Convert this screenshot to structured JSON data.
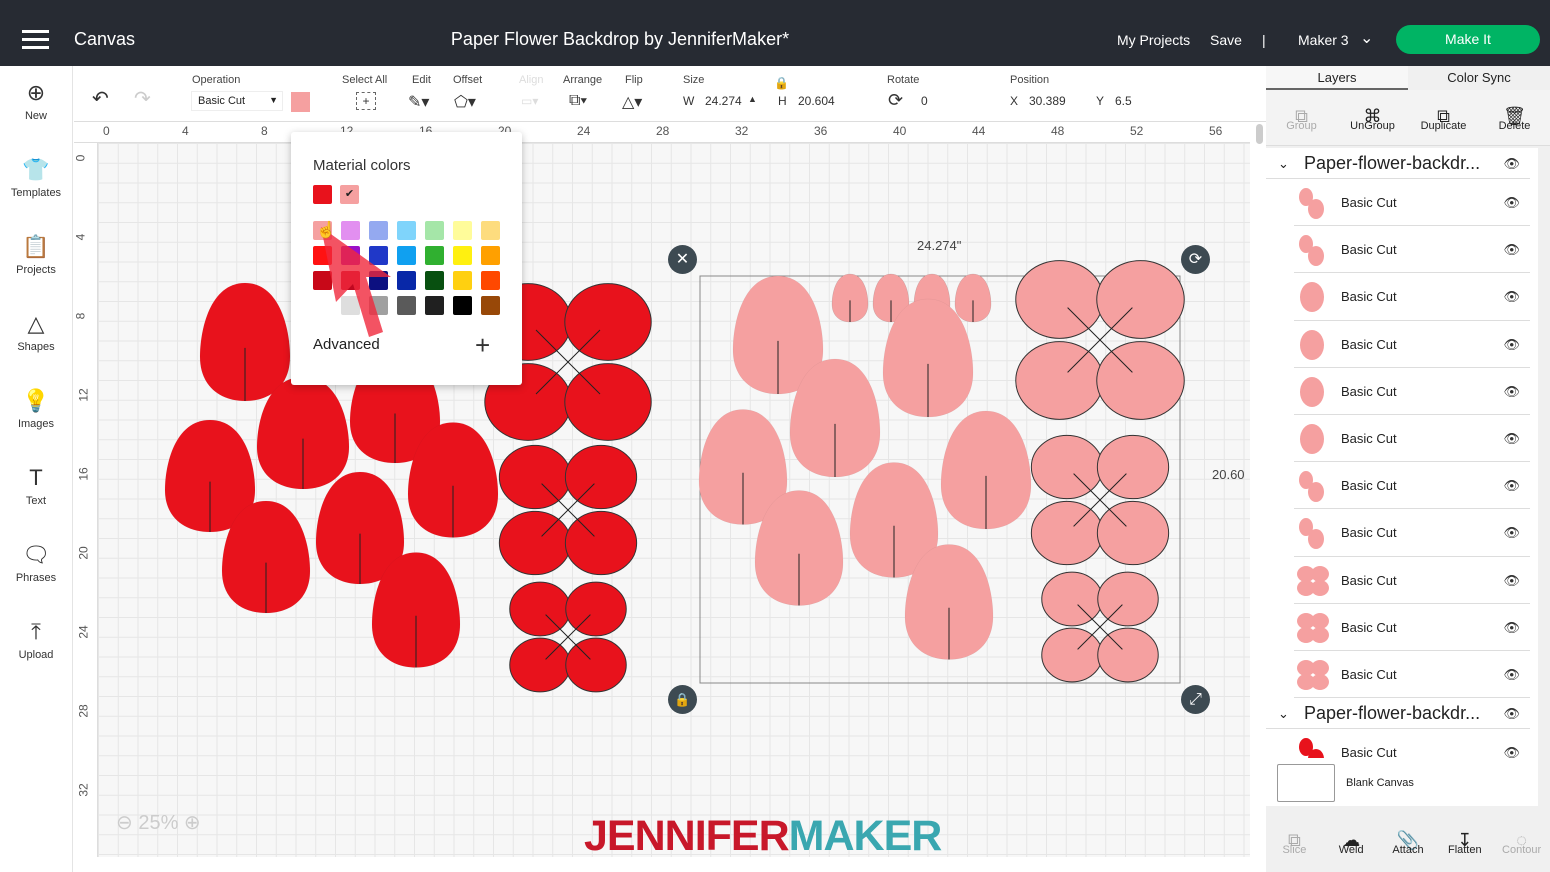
{
  "topbar": {
    "app": "Canvas",
    "title": "Paper Flower Backdrop by JenniferMaker*",
    "my_projects": "My Projects",
    "save": "Save",
    "separator": "|",
    "machine": "Maker 3",
    "make_it": "Make It",
    "accent": "#00b464"
  },
  "sidebar": [
    {
      "label": "New",
      "icon": "plus-circle-icon"
    },
    {
      "label": "Templates",
      "icon": "shirt-icon"
    },
    {
      "label": "Projects",
      "icon": "clipboard-icon"
    },
    {
      "label": "Shapes",
      "icon": "shapes-icon"
    },
    {
      "label": "Images",
      "icon": "bulb-icon"
    },
    {
      "label": "Text",
      "icon": "text-icon"
    },
    {
      "label": "Phrases",
      "icon": "speech-icon"
    },
    {
      "label": "Upload",
      "icon": "upload-icon"
    }
  ],
  "toolbar": {
    "operation_label": "Operation",
    "operation_value": "Basic Cut",
    "operation_color": "#f5a0a0",
    "select_all": "Select All",
    "edit": "Edit",
    "offset": "Offset",
    "align": "Align",
    "arrange": "Arrange",
    "flip": "Flip",
    "size": "Size",
    "w_label": "W",
    "w": "24.274",
    "h_label": "H",
    "h": "20.604",
    "rotate": "Rotate",
    "rotate_value": "0",
    "position": "Position",
    "x_label": "X",
    "x": "30.389",
    "y_label": "Y",
    "y": "6.5"
  },
  "ruler": {
    "top": [
      "0",
      "4",
      "8",
      "12",
      "16",
      "20",
      "24",
      "28",
      "32",
      "36",
      "40",
      "44",
      "48",
      "52",
      "56"
    ],
    "left": [
      "0",
      "4",
      "8",
      "12",
      "16",
      "20",
      "24",
      "28",
      "32"
    ]
  },
  "color_popup": {
    "title": "Material colors",
    "current": [
      "#e8121c",
      "#f5a0a0"
    ],
    "grid": [
      "#f5a0a0",
      "#e28ff0",
      "#94a9f0",
      "#7fd4fb",
      "#a5e6a8",
      "#fffc9a",
      "#fddc7e",
      "#ff1212",
      "#9a10c8",
      "#2038c8",
      "#10a0f0",
      "#30b030",
      "#fff010",
      "#ffa000",
      "#c80818",
      "#c00820",
      "#0c1080",
      "#0828a8",
      "#085010",
      "#ffd010",
      "#ff4800",
      "#ffffff",
      "#dedede",
      "#a0a0a0",
      "#5a5a5a",
      "#202020",
      "#000000",
      "#984808"
    ],
    "advanced": "Advanced"
  },
  "canvas": {
    "width_label": "24.274\"",
    "height_label": "20.60",
    "zoom": "25%",
    "logo_a": "JENNIFER",
    "logo_b": "MAKER",
    "red": "#e8121c",
    "pink": "#f5a0a0"
  },
  "layers_panel": {
    "tabs": [
      "Layers",
      "Color Sync"
    ],
    "actions": [
      "Group",
      "UnGroup",
      "Duplicate",
      "Delete"
    ],
    "groups": [
      {
        "name": "Paper-flower-backdr...",
        "items": [
          "Basic Cut",
          "Basic Cut",
          "Basic Cut",
          "Basic Cut",
          "Basic Cut",
          "Basic Cut",
          "Basic Cut",
          "Basic Cut",
          "Basic Cut",
          "Basic Cut",
          "Basic Cut"
        ]
      },
      {
        "name": "Paper-flower-backdr...",
        "items": [
          "Basic Cut"
        ]
      }
    ],
    "blank_canvas": "Blank Canvas",
    "bottom_actions": [
      "Slice",
      "Weld",
      "Attach",
      "Flatten",
      "Contour"
    ]
  }
}
